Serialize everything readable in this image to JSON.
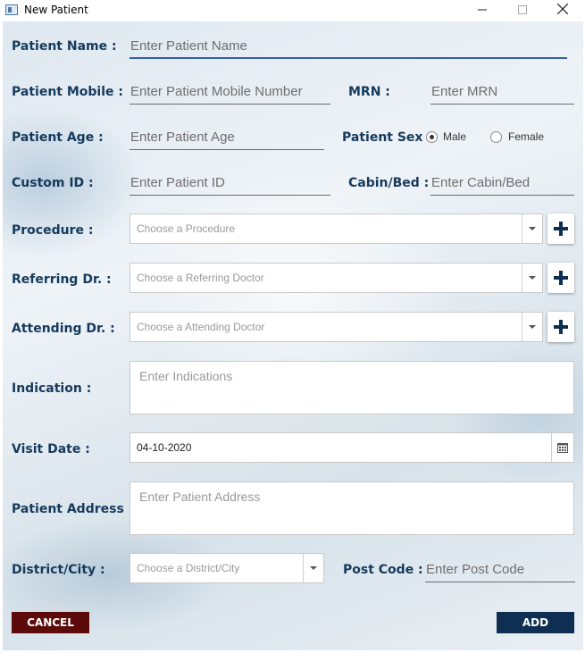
{
  "window": {
    "title": "New Patient",
    "controls": {
      "minimize": "—",
      "maximize": "☐",
      "close": "✕"
    }
  },
  "form": {
    "patient_name": {
      "label": "Patient Name :",
      "placeholder": "Enter Patient Name"
    },
    "patient_mobile": {
      "label": "Patient Mobile :",
      "placeholder": "Enter Patient Mobile Number"
    },
    "mrn": {
      "label": "MRN :",
      "placeholder": "Enter MRN"
    },
    "patient_age": {
      "label": "Patient Age :",
      "placeholder": "Enter Patient Age"
    },
    "patient_sex": {
      "label": "Patient Sex :",
      "options": [
        "Male",
        "Female"
      ],
      "selected": "Male"
    },
    "custom_id": {
      "label": "Custom ID :",
      "placeholder": "Enter Patient ID"
    },
    "cabin_bed": {
      "label": "Cabin/Bed :",
      "placeholder": "Enter Cabin/Bed"
    },
    "procedure": {
      "label": "Procedure :",
      "placeholder": "Choose a Procedure"
    },
    "referring_dr": {
      "label": "Referring Dr. :",
      "placeholder": "Choose a Referring Doctor"
    },
    "attending_dr": {
      "label": "Attending Dr. :",
      "placeholder": "Choose a Attending Doctor"
    },
    "indication": {
      "label": "Indication :",
      "placeholder": "Enter Indications"
    },
    "visit_date": {
      "label": "Visit Date :",
      "value": "04-10-2020"
    },
    "patient_address": {
      "label": "Patient Address :",
      "placeholder": "Enter Patient Address"
    },
    "district_city": {
      "label": "District/City :",
      "placeholder": "Choose a District/City"
    },
    "post_code": {
      "label": "Post Code :",
      "placeholder": "Enter Post Code"
    }
  },
  "buttons": {
    "cancel": "CANCEL",
    "add": "ADD"
  },
  "colors": {
    "label": "#163a5c",
    "cancel_bg": "#5c0a0a",
    "add_bg": "#0f2f52",
    "plus": "#0f2f52",
    "focus_underline": "#3a5da8"
  }
}
